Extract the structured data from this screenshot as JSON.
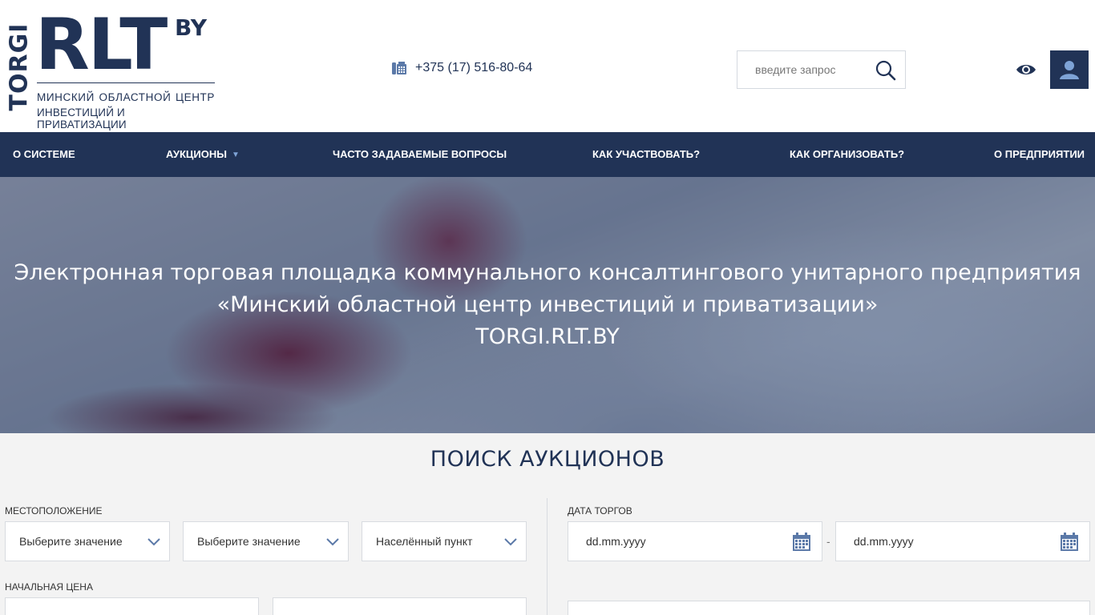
{
  "header": {
    "logo": {
      "torgi": "TORGI",
      "rlt": "RLT",
      "by": "BY",
      "subtitle_line1": "МИНСКИЙ ОБЛАСТНОЙ ЦЕНТР",
      "subtitle_line2": "ИНВЕСТИЦИЙ И ПРИВАТИЗАЦИИ"
    },
    "phone": "+375 (17) 516-80-64",
    "search": {
      "placeholder": "введите запрос"
    }
  },
  "nav": {
    "items": [
      {
        "label": "О СИСТЕМЕ"
      },
      {
        "label": "АУКЦИОНЫ"
      },
      {
        "label": "ЧАСТО ЗАДАВАЕМЫЕ ВОПРОСЫ"
      },
      {
        "label": "КАК УЧАСТВОВАТЬ?"
      },
      {
        "label": "КАК ОРГАНИЗОВАТЬ?"
      },
      {
        "label": "О ПРЕДПРИЯТИИ"
      }
    ]
  },
  "hero": {
    "line1": "Электронная торговая площадка коммунального консалтингового унитарного предприятия",
    "line2": "«Минский областной центр инвестиций и приватизации»",
    "line3": "TORGI.RLT.BY"
  },
  "search_section": {
    "title": "ПОИСК АУКЦИОНОВ",
    "location_label": "МЕСТОПОЛОЖЕНИЕ",
    "location_selects": [
      "Выберите значение",
      "Выберите значение",
      "Населённый пункт"
    ],
    "date_label": "ДАТА ТОРГОВ",
    "date_from_placeholder": "dd.mm.yyyy",
    "date_to_placeholder": "dd.mm.yyyy",
    "date_separator": "-",
    "price_label": "НАЧАЛЬНАЯ ЦЕНА"
  },
  "colors": {
    "brand": "#213356",
    "accent": "#7ea3d6",
    "background": "#f3f3f3"
  },
  "icons": {
    "phone": "phone-icon",
    "search": "search-icon",
    "eye": "eye-icon",
    "user": "user-icon",
    "chevron": "chevron-down-icon",
    "calendar": "calendar-icon"
  }
}
